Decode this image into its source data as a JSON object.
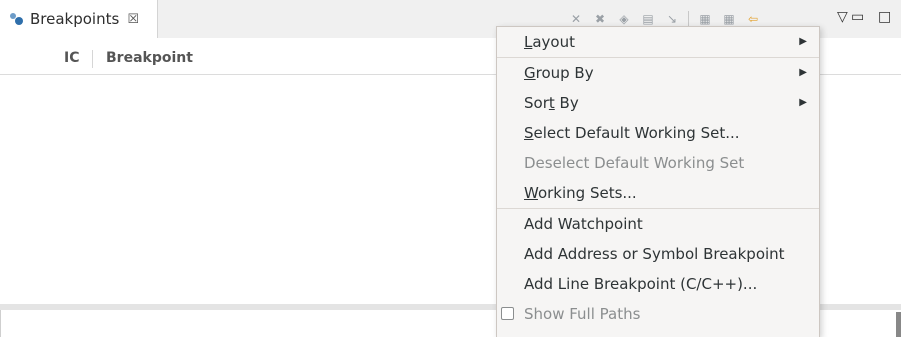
{
  "view": {
    "tab_title": "Breakpoints",
    "tab_close_glyph": "☒",
    "tab_icon": "breakpoint-icon"
  },
  "toolbar": {
    "icons": [
      "remove-breakpoint-icon",
      "remove-all-breakpoints-icon",
      "show-supported-breakpoints-icon",
      "go-to-file-icon",
      "skip-all-breakpoints-icon",
      "expand-all-icon",
      "collapse-all-icon",
      "link-with-debug-view-icon",
      "view-menu-icon"
    ],
    "view_menu_glyph": "▽",
    "minimize_glyph": "▭",
    "maximize_glyph": "□"
  },
  "table": {
    "columns": [
      "IC",
      "Breakpoint"
    ]
  },
  "menu": {
    "items": [
      {
        "pre": "",
        "mnemonic": "L",
        "post": "ayout",
        "submenu": true,
        "enabled": true
      },
      {
        "pre": "",
        "mnemonic": "G",
        "post": "roup By",
        "submenu": true,
        "enabled": true
      },
      {
        "pre": "Sor",
        "mnemonic": "t",
        "post": " By",
        "submenu": true,
        "enabled": true
      },
      {
        "pre": "",
        "mnemonic": "S",
        "post": "elect Default Working Set...",
        "submenu": false,
        "enabled": true
      },
      {
        "pre": "Deselect Default Working Set",
        "mnemonic": "",
        "post": "",
        "submenu": false,
        "enabled": false
      },
      {
        "pre": "",
        "mnemonic": "W",
        "post": "orking Sets...",
        "submenu": false,
        "enabled": true
      },
      {
        "pre": "Add Watchpoint",
        "mnemonic": "",
        "post": "",
        "submenu": false,
        "enabled": true
      },
      {
        "pre": "Add Address or Symbol Breakpoint",
        "mnemonic": "",
        "post": "",
        "submenu": false,
        "enabled": true
      },
      {
        "pre": "Add Line Breakpoint (C/C++)...",
        "mnemonic": "",
        "post": "",
        "submenu": false,
        "enabled": true
      },
      {
        "pre": "Show Full Paths",
        "mnemonic": "",
        "post": "",
        "submenu": false,
        "enabled": false,
        "checkbox": true,
        "checked": false
      }
    ],
    "submenu_arrow": "▶"
  },
  "colors": {
    "accent": "#2f6fab",
    "menu_bg": "#f6f5f4",
    "disabled_text": "#8b8e8f"
  }
}
